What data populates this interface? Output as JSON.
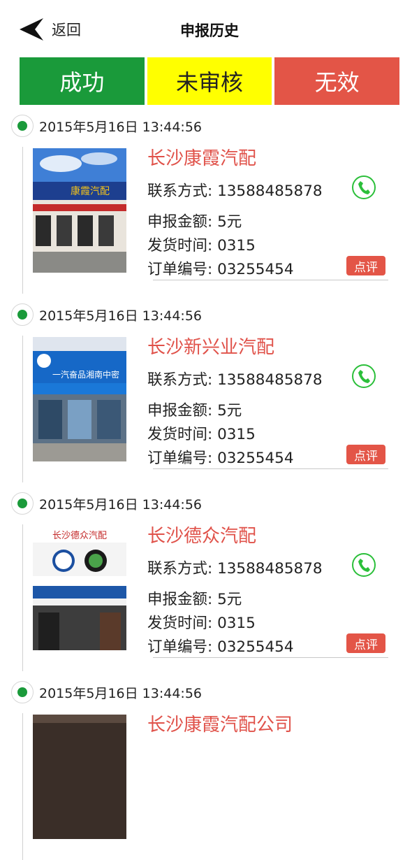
{
  "header": {
    "back_label": "返回",
    "title": "申报历史"
  },
  "tabs": [
    {
      "label": "成功",
      "color": "#1a9a3a"
    },
    {
      "label": "未审核",
      "color": "#ffff00"
    },
    {
      "label": "无效",
      "color": "#e35547"
    }
  ],
  "entries": [
    {
      "time": "2015年5月16日 13:44:56",
      "shop": "长沙康霞汽配",
      "contact": "联系方式: 13588485878",
      "amount": "申报金额: 5元",
      "ship": "发货时间: 0315",
      "order": "订单编号: 03255454",
      "review": "点评",
      "photo_sign": "康霞汽配"
    },
    {
      "time": "2015年5月16日 13:44:56",
      "shop": "长沙新兴业汽配",
      "contact": "联系方式: 13588485878",
      "amount": "申报金额: 5元",
      "ship": "发货时间: 0315",
      "order": "订单编号: 03255454",
      "review": "点评",
      "photo_sign": "一汽奋品湘南中密"
    },
    {
      "time": "2015年5月16日 13:44:56",
      "shop": "长沙德众汽配",
      "contact": "联系方式: 13588485878",
      "amount": "申报金额: 5元",
      "ship": "发货时间: 0315",
      "order": "订单编号: 03255454",
      "review": "点评",
      "photo_sign": "长沙德众汽配"
    },
    {
      "time": "2015年5月16日 13:44:56",
      "shop": "长沙康霞汽配公司"
    }
  ],
  "icons": {
    "back": "back-arrow-icon",
    "phone": "phone-icon",
    "timeline_dot": "green-dot-icon"
  },
  "colors": {
    "accent_green": "#1a9a3a",
    "accent_red": "#e35547",
    "shop_name": "#e0524a"
  }
}
